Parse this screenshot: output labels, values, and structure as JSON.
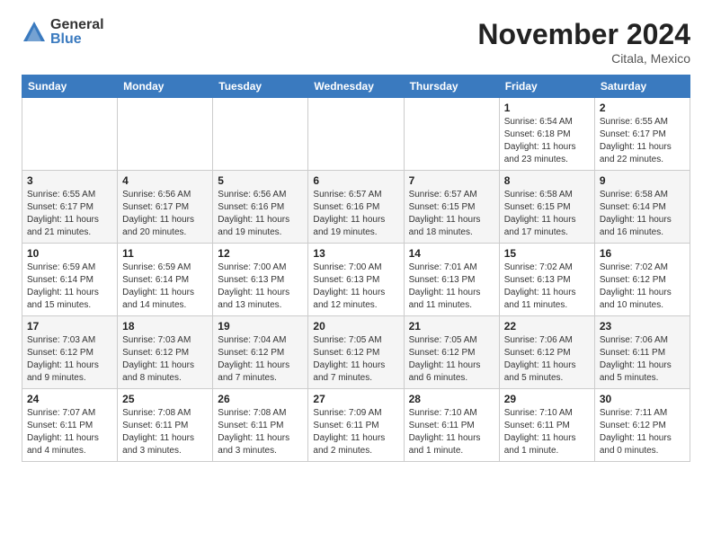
{
  "logo": {
    "general": "General",
    "blue": "Blue"
  },
  "title": "November 2024",
  "location": "Citala, Mexico",
  "days_of_week": [
    "Sunday",
    "Monday",
    "Tuesday",
    "Wednesday",
    "Thursday",
    "Friday",
    "Saturday"
  ],
  "weeks": [
    [
      {
        "day": "",
        "info": ""
      },
      {
        "day": "",
        "info": ""
      },
      {
        "day": "",
        "info": ""
      },
      {
        "day": "",
        "info": ""
      },
      {
        "day": "",
        "info": ""
      },
      {
        "day": "1",
        "info": "Sunrise: 6:54 AM\nSunset: 6:18 PM\nDaylight: 11 hours\nand 23 minutes."
      },
      {
        "day": "2",
        "info": "Sunrise: 6:55 AM\nSunset: 6:17 PM\nDaylight: 11 hours\nand 22 minutes."
      }
    ],
    [
      {
        "day": "3",
        "info": "Sunrise: 6:55 AM\nSunset: 6:17 PM\nDaylight: 11 hours\nand 21 minutes."
      },
      {
        "day": "4",
        "info": "Sunrise: 6:56 AM\nSunset: 6:17 PM\nDaylight: 11 hours\nand 20 minutes."
      },
      {
        "day": "5",
        "info": "Sunrise: 6:56 AM\nSunset: 6:16 PM\nDaylight: 11 hours\nand 19 minutes."
      },
      {
        "day": "6",
        "info": "Sunrise: 6:57 AM\nSunset: 6:16 PM\nDaylight: 11 hours\nand 19 minutes."
      },
      {
        "day": "7",
        "info": "Sunrise: 6:57 AM\nSunset: 6:15 PM\nDaylight: 11 hours\nand 18 minutes."
      },
      {
        "day": "8",
        "info": "Sunrise: 6:58 AM\nSunset: 6:15 PM\nDaylight: 11 hours\nand 17 minutes."
      },
      {
        "day": "9",
        "info": "Sunrise: 6:58 AM\nSunset: 6:14 PM\nDaylight: 11 hours\nand 16 minutes."
      }
    ],
    [
      {
        "day": "10",
        "info": "Sunrise: 6:59 AM\nSunset: 6:14 PM\nDaylight: 11 hours\nand 15 minutes."
      },
      {
        "day": "11",
        "info": "Sunrise: 6:59 AM\nSunset: 6:14 PM\nDaylight: 11 hours\nand 14 minutes."
      },
      {
        "day": "12",
        "info": "Sunrise: 7:00 AM\nSunset: 6:13 PM\nDaylight: 11 hours\nand 13 minutes."
      },
      {
        "day": "13",
        "info": "Sunrise: 7:00 AM\nSunset: 6:13 PM\nDaylight: 11 hours\nand 12 minutes."
      },
      {
        "day": "14",
        "info": "Sunrise: 7:01 AM\nSunset: 6:13 PM\nDaylight: 11 hours\nand 11 minutes."
      },
      {
        "day": "15",
        "info": "Sunrise: 7:02 AM\nSunset: 6:13 PM\nDaylight: 11 hours\nand 11 minutes."
      },
      {
        "day": "16",
        "info": "Sunrise: 7:02 AM\nSunset: 6:12 PM\nDaylight: 11 hours\nand 10 minutes."
      }
    ],
    [
      {
        "day": "17",
        "info": "Sunrise: 7:03 AM\nSunset: 6:12 PM\nDaylight: 11 hours\nand 9 minutes."
      },
      {
        "day": "18",
        "info": "Sunrise: 7:03 AM\nSunset: 6:12 PM\nDaylight: 11 hours\nand 8 minutes."
      },
      {
        "day": "19",
        "info": "Sunrise: 7:04 AM\nSunset: 6:12 PM\nDaylight: 11 hours\nand 7 minutes."
      },
      {
        "day": "20",
        "info": "Sunrise: 7:05 AM\nSunset: 6:12 PM\nDaylight: 11 hours\nand 7 minutes."
      },
      {
        "day": "21",
        "info": "Sunrise: 7:05 AM\nSunset: 6:12 PM\nDaylight: 11 hours\nand 6 minutes."
      },
      {
        "day": "22",
        "info": "Sunrise: 7:06 AM\nSunset: 6:12 PM\nDaylight: 11 hours\nand 5 minutes."
      },
      {
        "day": "23",
        "info": "Sunrise: 7:06 AM\nSunset: 6:11 PM\nDaylight: 11 hours\nand 5 minutes."
      }
    ],
    [
      {
        "day": "24",
        "info": "Sunrise: 7:07 AM\nSunset: 6:11 PM\nDaylight: 11 hours\nand 4 minutes."
      },
      {
        "day": "25",
        "info": "Sunrise: 7:08 AM\nSunset: 6:11 PM\nDaylight: 11 hours\nand 3 minutes."
      },
      {
        "day": "26",
        "info": "Sunrise: 7:08 AM\nSunset: 6:11 PM\nDaylight: 11 hours\nand 3 minutes."
      },
      {
        "day": "27",
        "info": "Sunrise: 7:09 AM\nSunset: 6:11 PM\nDaylight: 11 hours\nand 2 minutes."
      },
      {
        "day": "28",
        "info": "Sunrise: 7:10 AM\nSunset: 6:11 PM\nDaylight: 11 hours\nand 1 minute."
      },
      {
        "day": "29",
        "info": "Sunrise: 7:10 AM\nSunset: 6:11 PM\nDaylight: 11 hours\nand 1 minute."
      },
      {
        "day": "30",
        "info": "Sunrise: 7:11 AM\nSunset: 6:12 PM\nDaylight: 11 hours\nand 0 minutes."
      }
    ]
  ]
}
